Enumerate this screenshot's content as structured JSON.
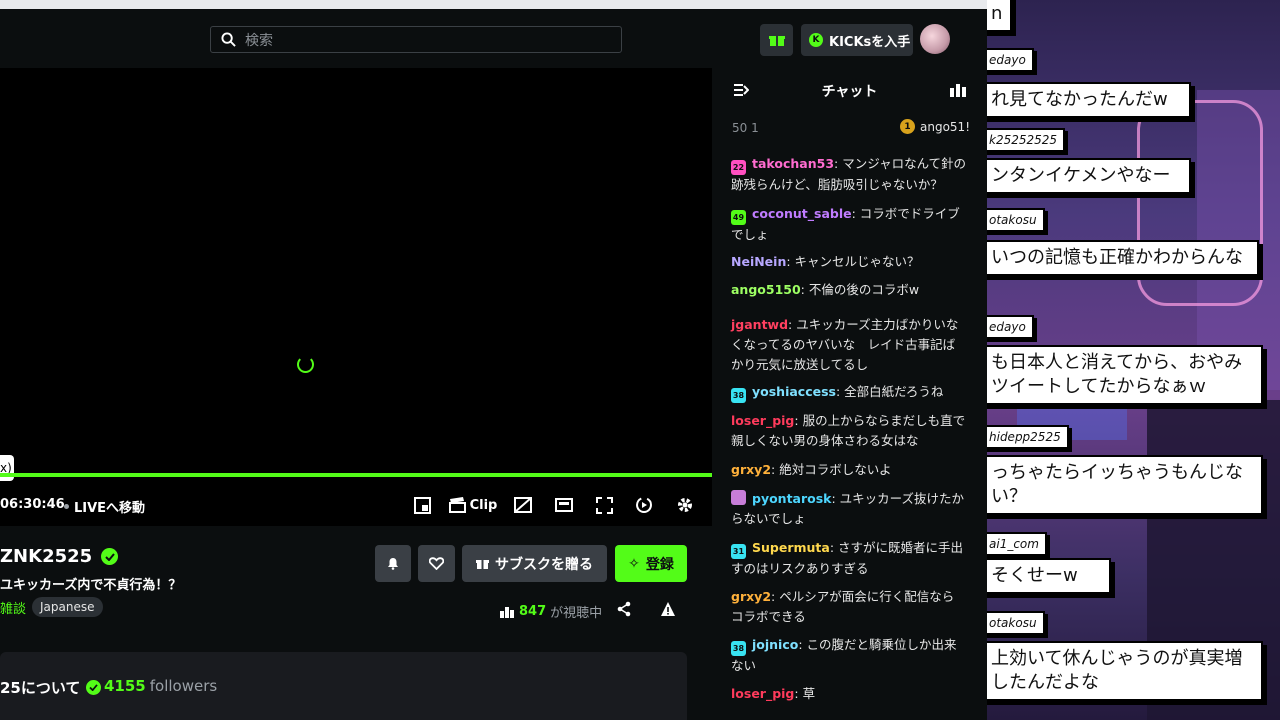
{
  "header": {
    "search_placeholder": "検索",
    "kicks_label": "KICKsを入手"
  },
  "player": {
    "tooltip_text": "x)",
    "time": "06:30:46",
    "live_label": "LIVEへ移動",
    "clip_label": "Clip"
  },
  "channel": {
    "name": "ZNK2525",
    "title": "ユキッカーズ内で不貞行為！？",
    "category": "雑談",
    "tag": "Japanese",
    "sub_gift_label": "サブスクを贈る",
    "follow_label": "登録",
    "viewer_count": "847",
    "viewer_label": "が視聴中",
    "about_title": "25について",
    "followers_count": "4155",
    "followers_label": "followers",
    "about_sub": "..."
  },
  "chat": {
    "title": "チャット",
    "pinned_left": "50 1",
    "pinned_right": "ango51!",
    "pinned_right_badge": "1",
    "messages": [
      {
        "badge": "22",
        "badge_color": "#ff4fc0",
        "user": "takochan53",
        "user_color": "#ff6cd0",
        "text": ": マンジャロなんて針の跡残らんけど、脂肪吸引じゃないか？"
      },
      {
        "badge": "49",
        "badge_color": "#53fc18",
        "user": "coconut_sable",
        "user_color": "#c07cff",
        "text": ": コラボでドライブでしょ"
      },
      {
        "badge": "",
        "badge_color": "",
        "user": "NeiNein",
        "user_color": "#b7a7ff",
        "text": ": キャンセルじゃない？"
      },
      {
        "badge": "",
        "badge_color": "",
        "user": "ango5150",
        "user_color": "#9dff63",
        "text": ": 不倫の後のコラボw"
      },
      {
        "badge": "",
        "badge_color": "",
        "user": "jgantwd",
        "user_color": "#ff4060",
        "text": ": ユキッカーズ主力ばかりいなくなってるのヤバいな　レイド古事記ばかり元気に放送してるし"
      },
      {
        "badge": "38",
        "badge_color": "#38e3f2",
        "user": "yoshiaccess",
        "user_color": "#7fe0ff",
        "text": ": 全部白紙だろうね"
      },
      {
        "badge": "",
        "badge_color": "",
        "user": "loser_pig",
        "user_color": "#ff3b5c",
        "text": ": 服の上からならまだしも直で親しくない男の身体さわる女はな"
      },
      {
        "badge": "",
        "badge_color": "",
        "user": "grxy2",
        "user_color": "#ffb13b",
        "text": ": 絶対コラボしないよ"
      },
      {
        "badge": "",
        "badge_color": "#c77dd8",
        "user": "pyontarosk",
        "user_color": "#4dd6ff",
        "text": ": ユキッカーズ抜けたからないでしょ"
      },
      {
        "badge": "31",
        "badge_color": "#38e3f2",
        "user": "Supermuta",
        "user_color": "#ffd84d",
        "text": ": さすがに既婚者に手出すのはリスクありすぎる"
      },
      {
        "badge": "",
        "badge_color": "",
        "user": "grxy2",
        "user_color": "#ffb13b",
        "text": ": ペルシアが面会に行く配信ならコラボできる"
      },
      {
        "badge": "38",
        "badge_color": "#38e3f2",
        "user": "jojnico",
        "user_color": "#7fe0ff",
        "text": ": この腹だと騎乗位しか出来ない"
      },
      {
        "badge": "",
        "badge_color": "",
        "user": "loser_pig",
        "user_color": "#ff3b5c",
        "text": ": 草"
      }
    ]
  },
  "overlay": {
    "comments": [
      {
        "text": "n",
        "small": false
      },
      {
        "text": "edayo",
        "small": true
      },
      {
        "text": "れ見てなかったんだw",
        "small": false
      },
      {
        "text": "k25252525",
        "small": true
      },
      {
        "text": "ンタンイケメンやなー",
        "small": false
      },
      {
        "text": "otakosu",
        "small": true
      },
      {
        "text": "いつの記憶も正確かわからんな",
        "small": false
      },
      {
        "text": "edayo",
        "small": true
      },
      {
        "text": "も日本人と消えてから、おやみツイートしてたからなぁｗ",
        "small": false
      },
      {
        "text": "hidepp2525",
        "small": true
      },
      {
        "text": "っちゃたらイッちゃうもんじない？",
        "small": false
      },
      {
        "text": "ai1_com",
        "small": true
      },
      {
        "text": "そくせーw",
        "small": false
      },
      {
        "text": "otakosu",
        "small": true
      },
      {
        "text": "上効いて休んじゃうのが真実増したんだよな",
        "small": false
      }
    ]
  },
  "colors": {
    "accent": "#53fc18",
    "background": "#0b0e0f",
    "panel": "#191b1f"
  }
}
